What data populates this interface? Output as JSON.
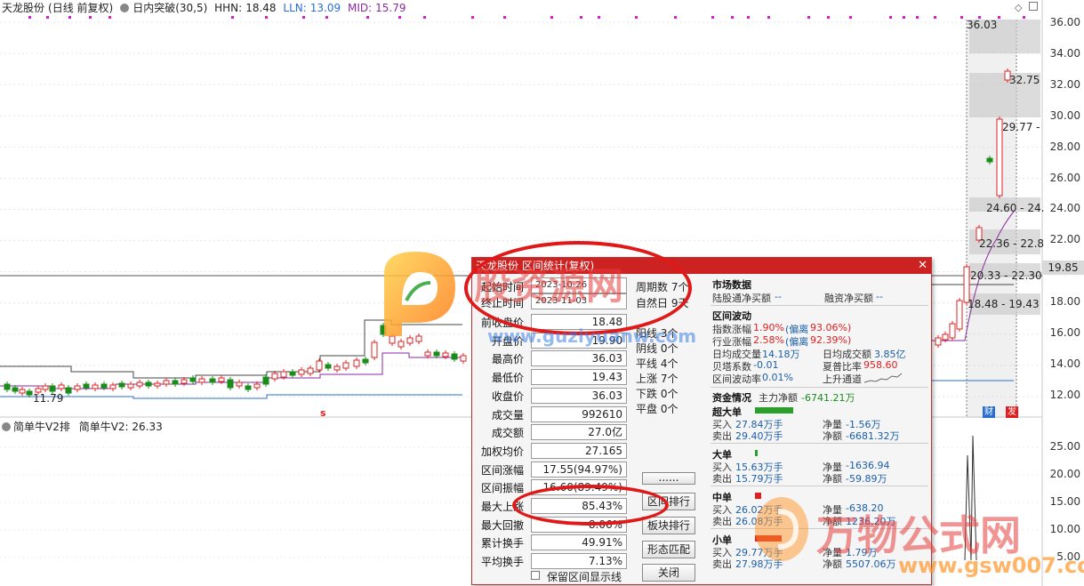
{
  "header": {
    "stock_name": "天龙股份",
    "period": "(日线 前复权)",
    "indicator": "日内突破(30,5)",
    "hhn_label": "HHN:",
    "hhn_value": "18.48",
    "lln_label": "LLN:",
    "lln_value": "13.09",
    "mid_label": "MID:",
    "mid_value": "15.79"
  },
  "y_axis": [
    "36.00",
    "34.00",
    "32.00",
    "30.00",
    "28.00",
    "26.00",
    "24.00",
    "22.00",
    "20.00",
    "18.00",
    "16.00",
    "14.00",
    "12.00"
  ],
  "y_axis_lower": [
    "25.00",
    "20.00",
    "15.00",
    "10.00",
    "5.00"
  ],
  "current_price_tag": "19.85",
  "chart_labels": {
    "low_mark": "11.79",
    "s_mark": "s",
    "l36": "36.03",
    "l3275": "32.75",
    "l2977": "29.77 -",
    "l2460": "24.60 - 24.",
    "l2236": "22.36 - 22.8",
    "l2033": "20.33 - 22.30",
    "l1848": "18.48 - 19.43",
    "tag_cai": "财",
    "tag_fa": "发"
  },
  "lower_header": {
    "name": "简单牛V2排",
    "series": "简单牛V2:",
    "value": "26.33"
  },
  "dialog": {
    "title": "天龙股份 区间统计(复权)",
    "start_label": "起始时间",
    "start_value": "2023-10-26",
    "end_label": "终止时间",
    "end_value": "2023-11-03",
    "fields": [
      {
        "label": "前收盘价",
        "value": "18.48"
      },
      {
        "label": "开盘价",
        "value": "19.90"
      },
      {
        "label": "最高价",
        "value": "36.03"
      },
      {
        "label": "最低价",
        "value": "19.43"
      },
      {
        "label": "收盘价",
        "value": "36.03"
      },
      {
        "label": "成交量",
        "value": "992610"
      },
      {
        "label": "成交额",
        "value": "27.0亿"
      },
      {
        "label": "加权均价",
        "value": "27.165"
      },
      {
        "label": "区间涨幅",
        "value": "17.55(94.97%)"
      },
      {
        "label": "区间振幅",
        "value": "16.60(89.49%)"
      },
      {
        "label": "最大上涨",
        "value": "85.43%"
      },
      {
        "label": "最大回撤",
        "value": "-8.06%"
      },
      {
        "label": "累计换手",
        "value": "49.91%"
      },
      {
        "label": "平均换手",
        "value": "7.13%"
      }
    ],
    "stats": [
      "周期数 7个",
      "自然日 9天",
      "阳线 3个",
      "阴线 0个",
      "平线 4个",
      "上涨 7个",
      "下跌 0个",
      "平盘 0个"
    ],
    "buttons": {
      "more": "......",
      "range_rank": "区间排行",
      "sector_rank": "板块排行",
      "pattern": "形态匹配",
      "close": "关闭"
    },
    "checkbox_label": "保留区间显示线",
    "market": {
      "title": "市场数据",
      "hk_label": "陆股通净买额",
      "hk_value": "--",
      "margin_label": "融资净买额",
      "margin_value": "--"
    },
    "volatility": {
      "title": "区间波动",
      "idx_label": "指数涨幅",
      "idx_value": "1.90%",
      "idx_dev_label": "(偏离",
      "idx_dev_value": "93.06%)",
      "ind_label": "行业涨幅",
      "ind_value": "2.58%",
      "ind_dev_label": "(偏离",
      "ind_dev_value": "92.39%)",
      "avg_vol_label": "日均成交量",
      "avg_vol_value": "14.18万",
      "avg_amt_label": "日均成交额",
      "avg_amt_value": "3.85亿",
      "beta_label": "贝塔系数",
      "beta_value": "-0.01",
      "sharpe_label": "夏普比率",
      "sharpe_value": "958.60",
      "vol_rate_label": "区间波动率",
      "vol_rate_value": "0.01%",
      "channel": "上升通道"
    },
    "funds": {
      "title": "资金情况",
      "main_label": "主力净额",
      "main_value": "-6741.21万",
      "groups": [
        {
          "name": "超大单",
          "buy": "27.84万手",
          "sell": "29.40万手",
          "net_vol": "-1.56万",
          "net_amt": "-6681.32万",
          "bar_color": "#2aa02a",
          "bar_fraction": 0.33
        },
        {
          "name": "大单",
          "buy": "15.63万手",
          "sell": "15.79万手",
          "net_vol": "-1636.94",
          "net_amt": "-59.89万",
          "bar_color": "#2aa02a",
          "bar_fraction": 0.02
        },
        {
          "name": "中单",
          "buy": "26.02万手",
          "sell": "26.08万手",
          "net_vol": "-638.20",
          "net_amt": "1236.20万",
          "bar_color": "#e02020",
          "bar_fraction": 0.05
        },
        {
          "name": "小单",
          "buy": "29.77万手",
          "sell": "27.98万手",
          "net_vol": "1.79万",
          "net_amt": "5507.06万",
          "bar_color": "#e02020",
          "bar_fraction": 0.23
        }
      ],
      "buy_label": "买入",
      "sell_label": "卖出",
      "net_vol_label": "净量",
      "net_amt_label": "净额"
    }
  },
  "watermarks": {
    "guzi_cn": "股资源网",
    "guzi_url": "www.guziyuanw.com",
    "wanwu_cn": "万物公式网",
    "wanwu_url": "www.gsw007.com"
  },
  "colors": {
    "up": "#e02020",
    "down": "#1a8c1a",
    "accent": "#c22222",
    "magenta": "#d020d0",
    "blue_line": "#2a6fd0",
    "purple_line": "#8a2aa0"
  }
}
